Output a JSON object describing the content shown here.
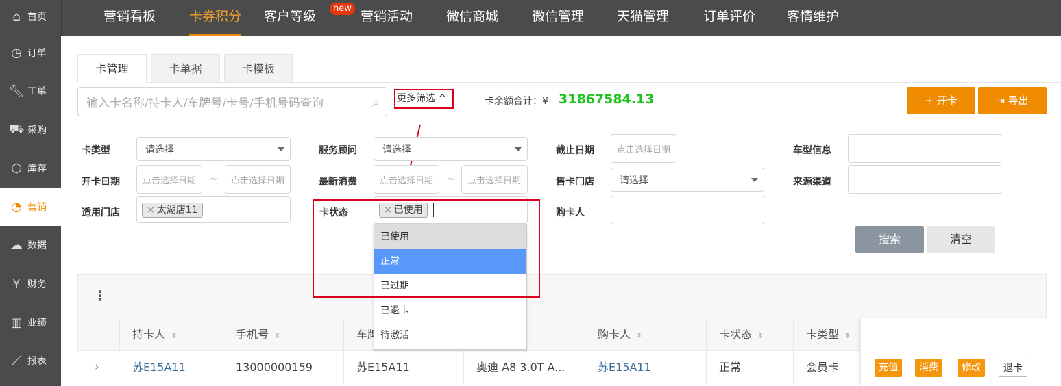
{
  "sidebar": {
    "items": [
      {
        "label": "首页",
        "icon": "home-icon",
        "glyph": "⌂"
      },
      {
        "label": "订单",
        "icon": "clock-icon",
        "glyph": "◷"
      },
      {
        "label": "工单",
        "icon": "wrench-icon",
        "glyph": "🔧︎"
      },
      {
        "label": "采购",
        "icon": "cart-icon",
        "glyph": "⛟"
      },
      {
        "label": "库存",
        "icon": "box-icon",
        "glyph": "⬡"
      },
      {
        "label": "营销",
        "icon": "pie-chart-icon",
        "glyph": "◔",
        "active": true
      },
      {
        "label": "数据",
        "icon": "cloud-icon",
        "glyph": "☁"
      },
      {
        "label": "财务",
        "icon": "yen-icon",
        "glyph": "¥"
      },
      {
        "label": "业绩",
        "icon": "bar-chart-icon",
        "glyph": "▥"
      },
      {
        "label": "报表",
        "icon": "line-chart-icon",
        "glyph": "⟋"
      }
    ]
  },
  "topnav": {
    "items": [
      "营销看板",
      "卡券积分",
      "客户等级",
      "营销活动",
      "微信商城",
      "微信管理",
      "天猫管理",
      "订单评价",
      "客情维护"
    ],
    "active": "卡券积分",
    "badge": "new"
  },
  "tabs": [
    "卡管理",
    "卡单据",
    "卡模板"
  ],
  "search": {
    "placeholder": "输入卡名称/持卡人/车牌号/卡号/手机号码查询",
    "more_filter": "更多筛选 ^"
  },
  "balance": {
    "label": "卡余额合计：¥",
    "value": "31867584.13",
    "color": "#1ec31e"
  },
  "buttons": {
    "open_card": "+ 开卡",
    "export": "导出",
    "search": "搜索",
    "clear": "清空",
    "accent": "#f08a00"
  },
  "filters": {
    "card_type": {
      "label": "卡类型",
      "value": "请选择"
    },
    "advisor": {
      "label": "服务顾问",
      "value": "请选择"
    },
    "deadline": {
      "label": "截止日期",
      "placeholder": "点击选择日期"
    },
    "car_info": {
      "label": "车型信息",
      "value": ""
    },
    "open_date": {
      "label": "开卡日期",
      "placeholder": "点击选择日期",
      "sep": "~"
    },
    "last_consume": {
      "label": "最新消费",
      "placeholder": "点击选择日期",
      "sep": "~"
    },
    "store_sold": {
      "label": "售卡门店",
      "value": "请选择"
    },
    "source": {
      "label": "来源渠道",
      "value": ""
    },
    "store": {
      "label": "适用门店",
      "tag": "太湖店11"
    },
    "status": {
      "label": "卡状态",
      "tag": "已使用",
      "options": [
        "已使用",
        "正常",
        "已过期",
        "已退卡",
        "待激活"
      ],
      "highlighted": "正常",
      "selected": "已使用"
    },
    "buyer": {
      "label": "购卡人",
      "value": ""
    }
  },
  "table": {
    "headers": [
      "持卡人",
      "手机号",
      "车牌",
      "",
      "购卡人",
      "卡状态",
      "卡类型"
    ],
    "rows": [
      {
        "holder": "苏E15A11",
        "phone": "13000000159",
        "plate": "苏E15A11",
        "car": "奥迪 A8 3.0T A...",
        "buyer": "苏E15A11",
        "status": "正常",
        "type": "会员卡"
      }
    ],
    "actions": [
      "充值",
      "消费",
      "修改",
      "退卡"
    ]
  }
}
